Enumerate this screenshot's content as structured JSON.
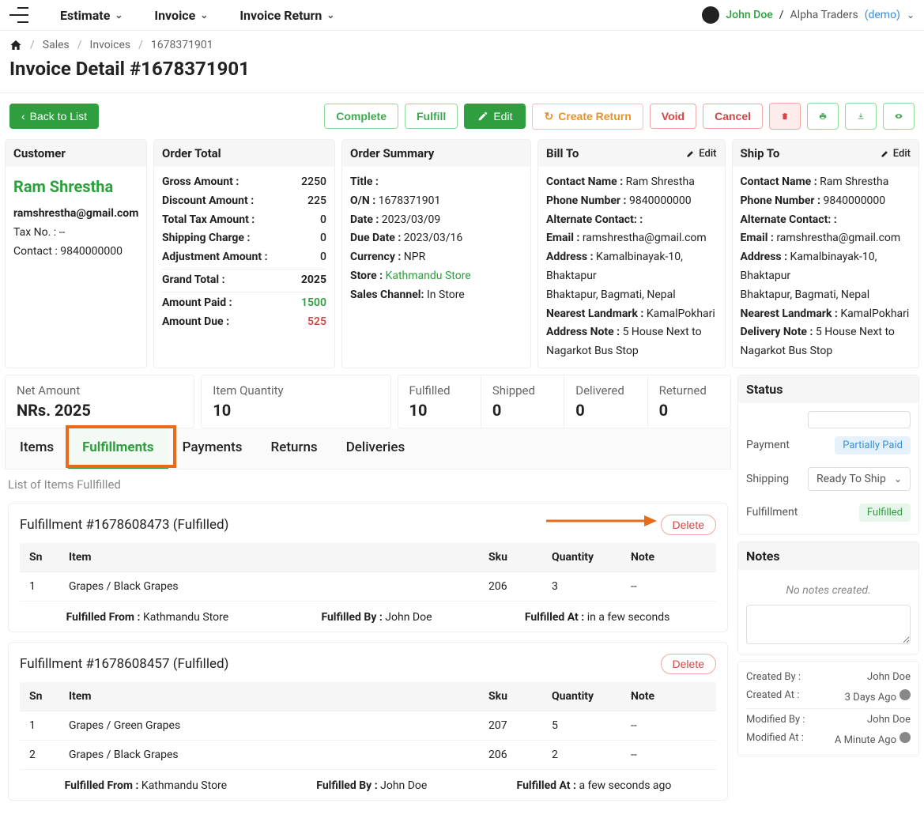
{
  "nav": {
    "items": [
      "Estimate",
      "Invoice",
      "Invoice Return"
    ],
    "user": "John Doe",
    "org": "Alpha Traders",
    "demo": "(demo)"
  },
  "breadcrumb": {
    "items": [
      "Sales",
      "Invoices",
      "1678371901"
    ]
  },
  "page_title": "Invoice Detail #1678371901",
  "toolbar": {
    "back": "Back to List",
    "complete": "Complete",
    "fulfill": "Fulfill",
    "edit": "Edit",
    "create_return": "Create Return",
    "void": "Void",
    "cancel": "Cancel"
  },
  "customer": {
    "header": "Customer",
    "name": "Ram Shrestha",
    "email": "ramshrestha@gmail.com",
    "tax_label": "Tax No. :",
    "tax_value": "--",
    "contact_label": "Contact :",
    "contact_value": "9840000000"
  },
  "order_total": {
    "header": "Order Total",
    "rows": [
      {
        "label": "Gross Amount :",
        "value": "2250"
      },
      {
        "label": "Discount Amount :",
        "value": "225"
      },
      {
        "label": "Total Tax Amount :",
        "value": "0"
      },
      {
        "label": "Shipping Charge :",
        "value": "0"
      },
      {
        "label": "Adjustment Amount :",
        "value": "0"
      }
    ],
    "grand_label": "Grand Total :",
    "grand_value": "2025",
    "paid_label": "Amount Paid :",
    "paid_value": "1500",
    "due_label": "Amount Due :",
    "due_value": "525"
  },
  "order_summary": {
    "header": "Order Summary",
    "title_l": "Title :",
    "title_v": "",
    "on_l": "O/N :",
    "on_v": "1678371901",
    "date_l": "Date :",
    "date_v": "2023/03/09",
    "due_l": "Due Date :",
    "due_v": "2023/03/16",
    "curr_l": "Currency :",
    "curr_v": "NPR",
    "store_l": "Store :",
    "store_v": "Kathmandu Store",
    "channel_l": "Sales Channel:",
    "channel_v": "In Store"
  },
  "bill_to": {
    "header": "Bill To",
    "edit": "Edit",
    "contact_l": "Contact Name :",
    "contact_v": "Ram Shrestha",
    "phone_l": "Phone Number :",
    "phone_v": "9840000000",
    "alt_l": "Alternate Contact: :",
    "alt_v": "",
    "email_l": "Email :",
    "email_v": "ramshrestha@gmail.com",
    "addr_l": "Address :",
    "addr_v": "Kamalbinayak-10, Bhaktapur",
    "addr_line2": "Bhaktapur, Bagmati, Nepal",
    "landmark_l": "Nearest Landmark :",
    "landmark_v": "KamalPokhari",
    "note_l": "Address Note :",
    "note_v": "5 House Next to Nagarkot Bus Stop"
  },
  "ship_to": {
    "header": "Ship To",
    "edit": "Edit",
    "contact_l": "Contact Name :",
    "contact_v": "Ram Shrestha",
    "phone_l": "Phone Number :",
    "phone_v": "9840000000",
    "alt_l": "Alternate Contact: :",
    "alt_v": "",
    "email_l": "Email :",
    "email_v": "ramshrestha@gmail.com",
    "addr_l": "Address :",
    "addr_v": "Kamalbinayak-10, Bhaktapur",
    "addr_line2": "Bhaktapur, Bagmati, Nepal",
    "landmark_l": "Nearest Landmark :",
    "landmark_v": "KamalPokhari",
    "note_l": "Delivery Note :",
    "note_v": "5 House Next to Nagarkot Bus Stop"
  },
  "metrics": {
    "net_l": "Net Amount",
    "net_v": "NRs. 2025",
    "qty_l": "Item Quantity",
    "qty_v": "10",
    "fulfilled_l": "Fulfilled",
    "fulfilled_v": "10",
    "shipped_l": "Shipped",
    "shipped_v": "0",
    "delivered_l": "Delivered",
    "delivered_v": "0",
    "returned_l": "Returned",
    "returned_v": "0"
  },
  "tabs": [
    "Items",
    "Fulfillments",
    "Payments",
    "Returns",
    "Deliveries"
  ],
  "section_subtitle": "List of Items Fullfilled",
  "fulfillments": [
    {
      "title": "Fulfillment #1678608473 (Fulfilled)",
      "delete": "Delete",
      "cols": [
        "Sn",
        "Item",
        "Sku",
        "Quantity",
        "Note"
      ],
      "rows": [
        {
          "sn": "1",
          "item": "Grapes / Black Grapes",
          "sku": "206",
          "qty": "3",
          "note": "--"
        }
      ],
      "from_l": "Fulfilled From :",
      "from_v": "Kathmandu Store",
      "by_l": "Fulfilled By :",
      "by_v": "John Doe",
      "at_l": "Fulfilled At :",
      "at_v": "in a few seconds"
    },
    {
      "title": "Fulfillment #1678608457 (Fulfilled)",
      "delete": "Delete",
      "cols": [
        "Sn",
        "Item",
        "Sku",
        "Quantity",
        "Note"
      ],
      "rows": [
        {
          "sn": "1",
          "item": "Grapes / Green Grapes",
          "sku": "207",
          "qty": "5",
          "note": "--"
        },
        {
          "sn": "2",
          "item": "Grapes / Black Grapes",
          "sku": "206",
          "qty": "2",
          "note": "--"
        }
      ],
      "from_l": "Fulfilled From :",
      "from_v": "Kathmandu Store",
      "by_l": "Fulfilled By :",
      "by_v": "John Doe",
      "at_l": "Fulfilled At :",
      "at_v": "a few seconds ago"
    }
  ],
  "status": {
    "header": "Status",
    "payment_l": "Payment",
    "payment_v": "Partially Paid",
    "shipping_l": "Shipping",
    "shipping_v": "Ready To Ship",
    "fulfillment_l": "Fulfillment",
    "fulfillment_v": "Fulfilled"
  },
  "notes": {
    "header": "Notes",
    "empty": "No notes created."
  },
  "meta": {
    "created_by_l": "Created By :",
    "created_by_v": "John Doe",
    "created_at_l": "Created At :",
    "created_at_v": "3 Days Ago",
    "modified_by_l": "Modified By :",
    "modified_by_v": "John Doe",
    "modified_at_l": "Modified At :",
    "modified_at_v": "A Minute Ago"
  }
}
